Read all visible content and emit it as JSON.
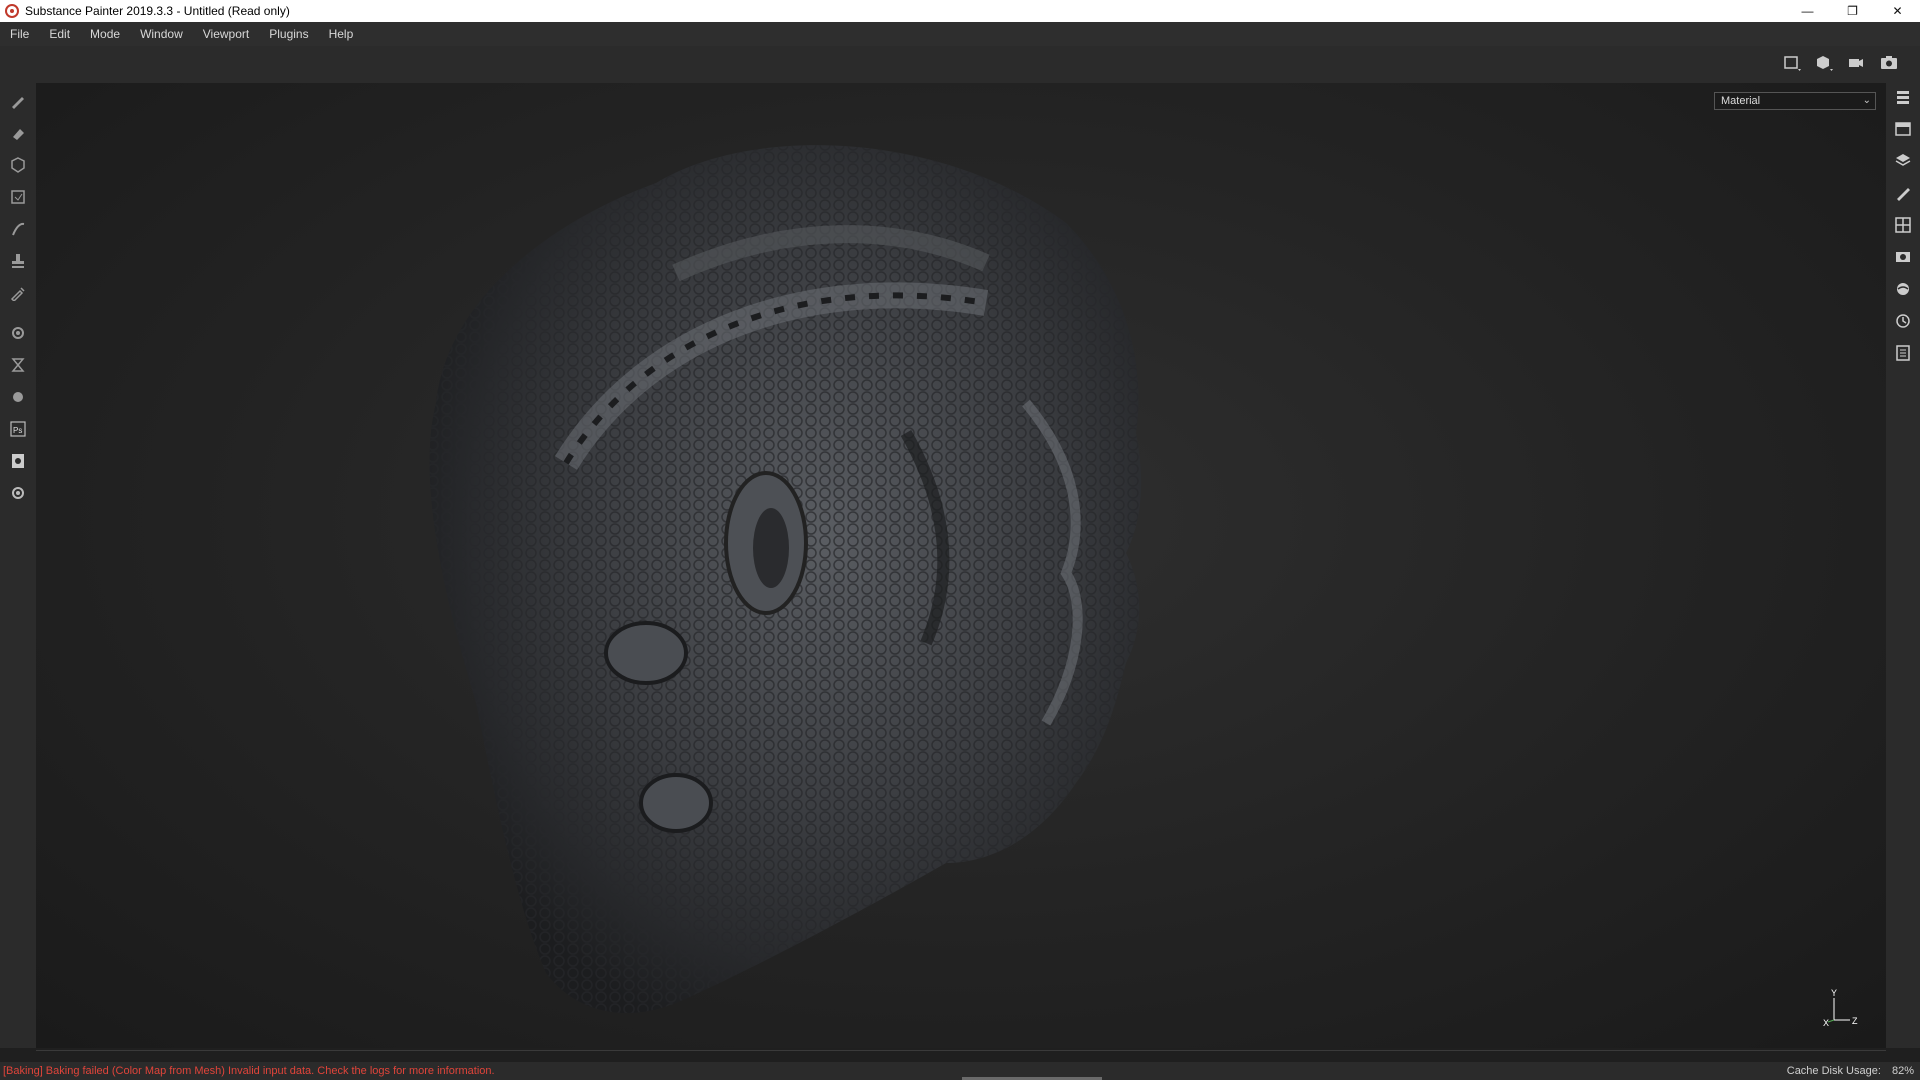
{
  "window": {
    "title": "Substance Painter 2019.3.3 - Untitled (Read only)",
    "controls": {
      "minimize": "—",
      "restore": "❐",
      "close": "✕"
    }
  },
  "menu": [
    "File",
    "Edit",
    "Mode",
    "Window",
    "Viewport",
    "Plugins",
    "Help"
  ],
  "viewport": {
    "display_mode": "Material",
    "axis": {
      "y": "Y",
      "x": "X",
      "z": "Z"
    }
  },
  "left_tools": [
    "paint-brush-icon",
    "eraser-icon",
    "projection-icon",
    "polygon-fill-icon",
    "smudge-icon",
    "clone-stamp-icon",
    "color-picker-icon",
    "bake-settings-icon",
    "hourglass-icon",
    "mesh-icon",
    "photoshop-icon",
    "export-icon",
    "settings-icon"
  ],
  "right_tools": [
    "layers-panel-icon",
    "texture-set-list-icon",
    "layer-stack-icon",
    "brush-properties-icon",
    "uv-display-icon",
    "camera-display-icon",
    "environment-icon",
    "history-icon",
    "log-icon"
  ],
  "status": {
    "error": "[Baking] Baking failed (Color Map from Mesh) Invalid input data. Check the logs for more information.",
    "cache_label": "Cache Disk Usage:",
    "cache_value": "82%"
  },
  "colors": {
    "error": "#e0443a",
    "accent": "#c0392b"
  }
}
